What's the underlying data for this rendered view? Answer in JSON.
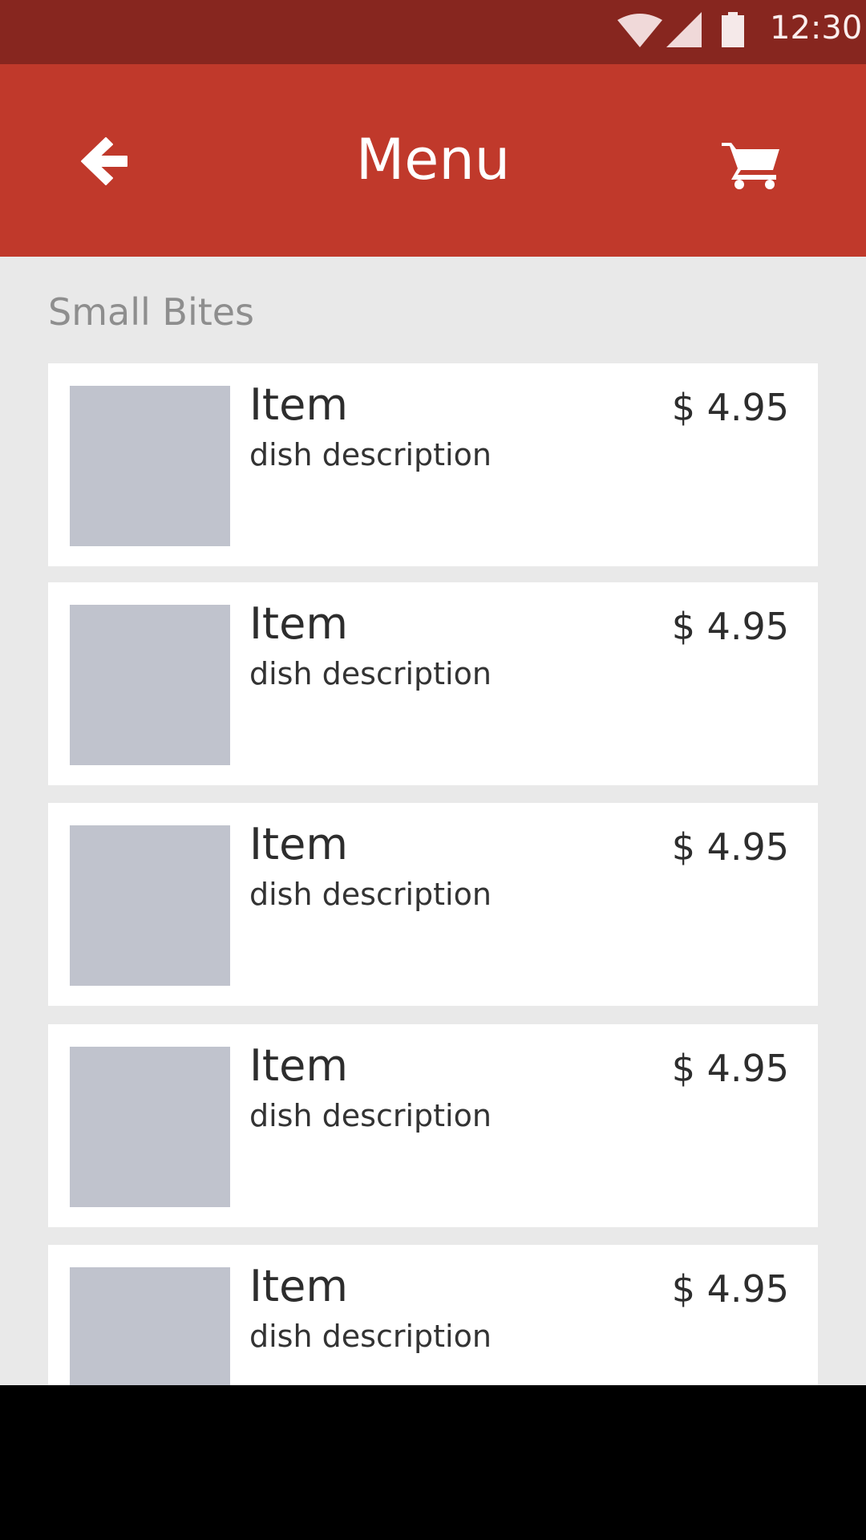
{
  "status_bar": {
    "time": "12:30",
    "icons": [
      "wifi-icon",
      "signal-icon",
      "battery-icon"
    ],
    "color": "#87261f"
  },
  "app_bar": {
    "title": "Menu",
    "back_icon": "arrow-left-icon",
    "cart_icon": "cart-icon",
    "color": "#c0392b"
  },
  "section": {
    "title": "Small Bites"
  },
  "items": [
    {
      "name": "Item",
      "description": "dish description",
      "price": "$ 4.95"
    },
    {
      "name": "Item",
      "description": "dish description",
      "price": "$ 4.95"
    },
    {
      "name": "Item",
      "description": "dish description",
      "price": "$ 4.95"
    },
    {
      "name": "Item",
      "description": "dish description",
      "price": "$ 4.95"
    },
    {
      "name": "Item",
      "description": "dish description",
      "price": "$ 4.95"
    }
  ]
}
